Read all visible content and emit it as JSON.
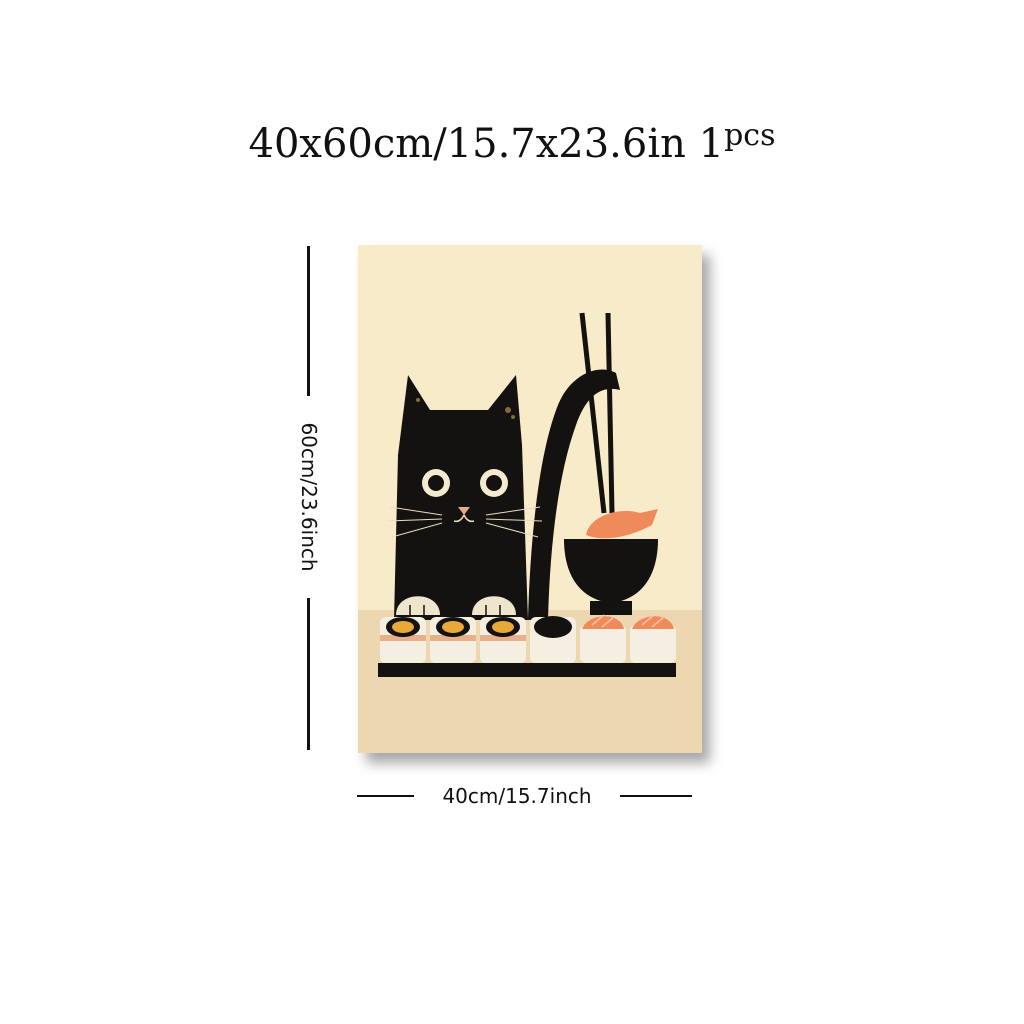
{
  "header": {
    "size_text": "40x60cm/15.7x23.6in 1",
    "qty_suffix": "pcs"
  },
  "dimensions": {
    "height_label": "60cm/23.6inch",
    "width_label": "40cm/15.7inch"
  },
  "poster": {
    "subject": "black cat with sushi and chopsticks",
    "colors": {
      "background": "#f7ebc9",
      "table": "#ecd7b1",
      "cat": "#141210",
      "salmon": "#ef8a5a",
      "rice": "#f5efe2",
      "egg_yolk": "#e8a93a"
    }
  }
}
